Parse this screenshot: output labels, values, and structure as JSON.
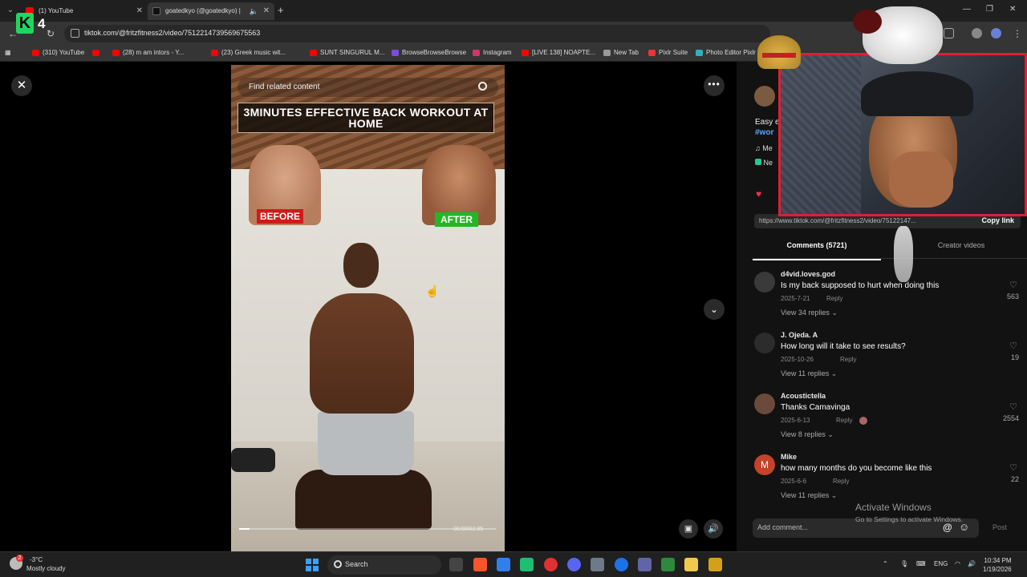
{
  "browser": {
    "tabs": [
      {
        "title": "(1) YouTube",
        "active": false
      },
      {
        "title": "goatedkyo (@goatedkyo) |",
        "active": true
      }
    ],
    "url": "tiktok.com/@fritzfitness2/video/7512214739569675563",
    "bookmarks": [
      "(310) YouTube",
      "(28) m am intors - Y...",
      "(23) Greek music wit...",
      "SUNT SINGURUL M...",
      "BrowseBrowseBrowse",
      "Instagram",
      "[LIVE 138] NOAPTE...",
      "New Tab",
      "Pixlr Suite",
      "Photo Editor Pixlr"
    ]
  },
  "overlay": {
    "k_letter": "K",
    "k_count": "4"
  },
  "video": {
    "search_placeholder": "Find related content",
    "title": "3MINUTES EFFECTIVE BACK WORKOUT AT HOME",
    "tag_before": "BEFORE",
    "tag_after": "AFTER",
    "progress": 0.04,
    "timecode": "00:00/02:35"
  },
  "post": {
    "desc": "Easy e",
    "hashtag": "#wor",
    "music": "Me",
    "effect": "Ne",
    "link": "https://www.tiktok.com/@fritzfitness2/video/75122147...",
    "copy_label": "Copy link",
    "tab_comments": "Comments (5721)",
    "tab_creator": "Creator videos"
  },
  "comments": [
    {
      "avatar": "",
      "user": "d4vid.loves.god",
      "text": "Is my back supposed to hurt when doing this",
      "date": "2025-7-21",
      "reply": "Reply",
      "replies": "View 34 replies",
      "likes": "563",
      "avatar_color": "#3a3a3a"
    },
    {
      "avatar": "",
      "user": "J. Ojeda. A",
      "text": "How long will it take to see results?",
      "date": "2025-10-26",
      "reply": "Reply",
      "replies": "View 11 replies",
      "likes": "19",
      "avatar_color": "#2c2c2c"
    },
    {
      "avatar": "",
      "user": "Acoustictella",
      "text": "Thanks Camavinga",
      "date": "2025-6-13",
      "reply": "Reply",
      "replies": "View 8 replies",
      "likes": "2554",
      "avatar_color": "#6a4a3a"
    },
    {
      "avatar": "M",
      "user": "Mike",
      "text": "how many months do you become like this",
      "date": "2025-6-6",
      "reply": "Reply",
      "replies": "View 11 replies",
      "likes": "22",
      "avatar_color": "#c4432b"
    }
  ],
  "composer": {
    "placeholder": "Add comment...",
    "at": "@",
    "post": "Post"
  },
  "watermark": {
    "line1": "Activate Windows",
    "line2": "Go to Settings to activate Windows."
  },
  "taskbar": {
    "weather_badge": "2",
    "temperature": "-3°C",
    "weather": "Mostly cloudy",
    "search": "Search",
    "lang": "ENG",
    "time": "10:34 PM",
    "date": "1/19/2026"
  },
  "colors": {
    "accent_red": "#fe2c55",
    "webcam_border": "#e11d36",
    "before_red": "#d01a1a",
    "after_green": "#22b822"
  }
}
